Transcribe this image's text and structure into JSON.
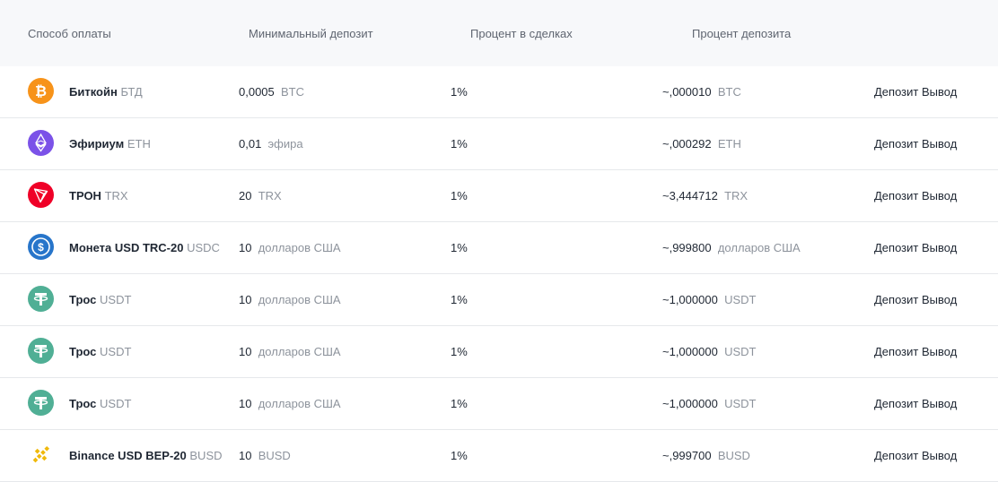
{
  "columns": {
    "method": "Способ оплаты",
    "min_deposit": "Минимальный депозит",
    "trade_percent": "Процент в сделках",
    "deposit_percent": "Процент депозита"
  },
  "actions": {
    "deposit": "Депозит",
    "withdraw": "Вывод"
  },
  "rows": [
    {
      "icon": "bitcoin-icon",
      "name": "Биткойн",
      "ticker": "БТД",
      "min_value": "0,0005",
      "min_unit": "BTC",
      "percent": "1%",
      "dep_value": "~,000010",
      "dep_unit": "BTC",
      "color": "#f7931a"
    },
    {
      "icon": "ethereum-icon",
      "name": "Эфириум",
      "ticker": "ETH",
      "min_value": "0,01",
      "min_unit": "эфира",
      "percent": "1%",
      "dep_value": "~,000292",
      "dep_unit": "ETH",
      "color": "#7b52e8"
    },
    {
      "icon": "tron-icon",
      "name": "ТРОН",
      "ticker": "TRX",
      "min_value": "20",
      "min_unit": "TRX",
      "percent": "1%",
      "dep_value": "~3,444712",
      "dep_unit": "TRX",
      "color": "#ef0027"
    },
    {
      "icon": "usdc-icon",
      "name": "Монета USD TRC-20",
      "ticker": "USDC",
      "min_value": "10",
      "min_unit": "долларов США",
      "percent": "1%",
      "dep_value": "~,999800",
      "dep_unit": "долларов США",
      "color": "#2775ca"
    },
    {
      "icon": "tether-icon",
      "name": "Трос",
      "ticker": "USDT",
      "min_value": "10",
      "min_unit": "долларов США",
      "percent": "1%",
      "dep_value": "~1,000000",
      "dep_unit": "USDT",
      "color": "#50af95"
    },
    {
      "icon": "tether-icon",
      "name": "Трос",
      "ticker": "USDT",
      "min_value": "10",
      "min_unit": "долларов США",
      "percent": "1%",
      "dep_value": "~1,000000",
      "dep_unit": "USDT",
      "color": "#50af95"
    },
    {
      "icon": "tether-icon",
      "name": "Трос",
      "ticker": "USDT",
      "min_value": "10",
      "min_unit": "долларов США",
      "percent": "1%",
      "dep_value": "~1,000000",
      "dep_unit": "USDT",
      "color": "#50af95"
    },
    {
      "icon": "binance-usd-icon",
      "name": "Binance USD BEP-20",
      "ticker": "BUSD",
      "min_value": "10",
      "min_unit": "BUSD",
      "percent": "1%",
      "dep_value": "~,999700",
      "dep_unit": "BUSD",
      "color": "#f0b90b"
    }
  ]
}
